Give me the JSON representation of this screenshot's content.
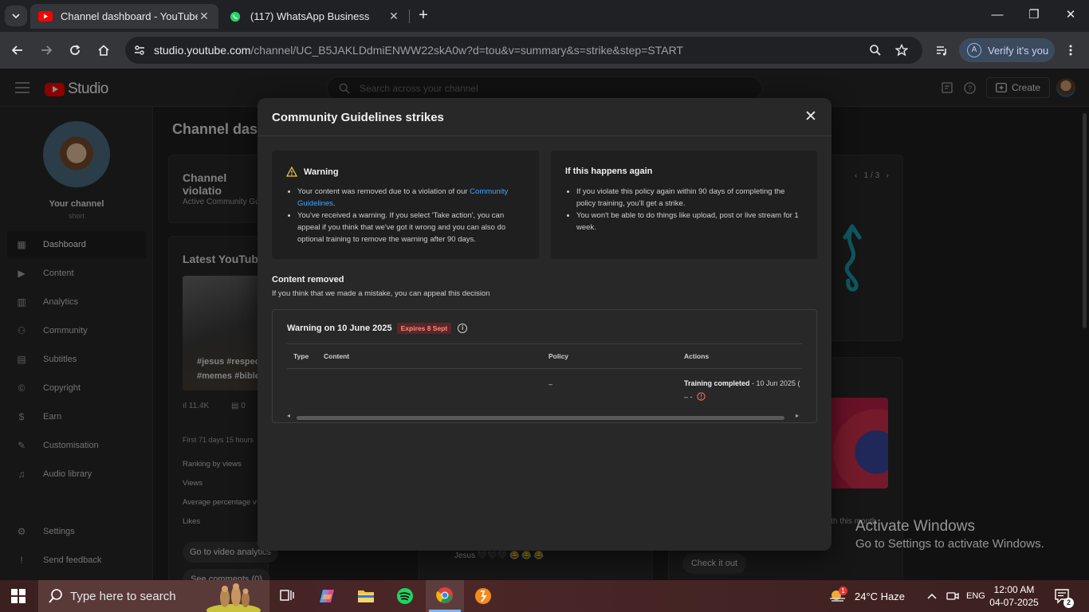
{
  "browser": {
    "tabs": [
      {
        "title": "Channel dashboard - YouTube S",
        "active": true
      },
      {
        "title": "(117) WhatsApp Business",
        "active": false
      }
    ],
    "url_host": "studio.youtube.com",
    "url_rest": "/channel/UC_B5JAKLDdmiENWW22skA0w?d=tou&v=summary&s=strike&step=START",
    "verify_label": "Verify it's you",
    "verify_avatar": "A"
  },
  "studio": {
    "logo_text": "Studio",
    "search_placeholder": "Search across your channel",
    "create_label": "Create",
    "channel_name": "Your channel",
    "channel_sub": "short",
    "nav": [
      {
        "label": "Dashboard",
        "icon": "dashboard-icon",
        "selected": true
      },
      {
        "label": "Content",
        "icon": "content-icon"
      },
      {
        "label": "Analytics",
        "icon": "analytics-icon"
      },
      {
        "label": "Community",
        "icon": "community-icon"
      },
      {
        "label": "Subtitles",
        "icon": "subtitles-icon"
      },
      {
        "label": "Copyright",
        "icon": "copyright-icon"
      },
      {
        "label": "Earn",
        "icon": "earn-icon"
      },
      {
        "label": "Customisation",
        "icon": "customisation-icon"
      },
      {
        "label": "Audio library",
        "icon": "audio-library-icon"
      }
    ],
    "nav_bottom": [
      {
        "label": "Settings",
        "icon": "settings-icon"
      },
      {
        "label": "Send feedback",
        "icon": "feedback-icon"
      }
    ],
    "dashboard": {
      "title": "Channel dash",
      "violation_title": "Channel violatio",
      "violation_text": "Active Community Gu",
      "latest_title": "Latest YouTube",
      "video_tags_1": "#jesus #respec",
      "video_tags_2": "#memes #bible",
      "views": "11.4K",
      "comments": "0",
      "first_days": "First 71 days 15 hours",
      "ranking": "Ranking by views",
      "views_label": "Views",
      "avg_pct": "Average percentage v",
      "likes": "Likes",
      "go_analytics": "Go to video analytics",
      "see_comments": "See comments (0)",
      "pager": "1 / 3",
      "check_it_out": "Check it out",
      "comment_preview": "Jesus 🖤🖤🖤 😂 😂 😂",
      "this_month": "ith this month"
    }
  },
  "dialog": {
    "title": "Community Guidelines strikes",
    "warning": {
      "heading": "Warning",
      "bullet1_pre": "Your content was removed due to a violation of our ",
      "bullet1_link": "Community Guidelines",
      "bullet1_post": ".",
      "bullet2": "You've received a warning. If you select 'Take action', you can appeal if you think that we've got it wrong and you can also do optional training to remove the warning after 90 days."
    },
    "again": {
      "heading": "If this happens again",
      "bullet1": "If you violate this policy again within 90 days of completing the policy training, you'll get a strike.",
      "bullet2": "You won't be able to do things like upload, post or live stream for 1 week."
    },
    "removed_title": "Content removed",
    "removed_sub": "If you think that we made a mistake, you can appeal this decision",
    "strike": {
      "heading": "Warning on 10 June 2025",
      "badge": "Expires 8 Sept",
      "columns": [
        "Type",
        "Content",
        "Policy",
        "Actions"
      ],
      "policy_value": "–",
      "action_strong": "Training completed",
      "action_rest": " - 10 Jun 2025 (",
      "action_line2": "– -"
    }
  },
  "watermark": {
    "line1": "Activate Windows",
    "line2": "Go to Settings to activate Windows."
  },
  "taskbar": {
    "search_placeholder": "Type here to search",
    "weather": "24°C  Haze",
    "weather_badge": "1",
    "lang": "ENG",
    "time": "12:00 AM",
    "date": "04-07-2025",
    "notifications": "2"
  },
  "colors": {
    "yt_red": "#ff0000",
    "link_blue": "#3ea6ff",
    "badge_red": "#ff8a80",
    "verify_bg": "#3c4a5e"
  }
}
